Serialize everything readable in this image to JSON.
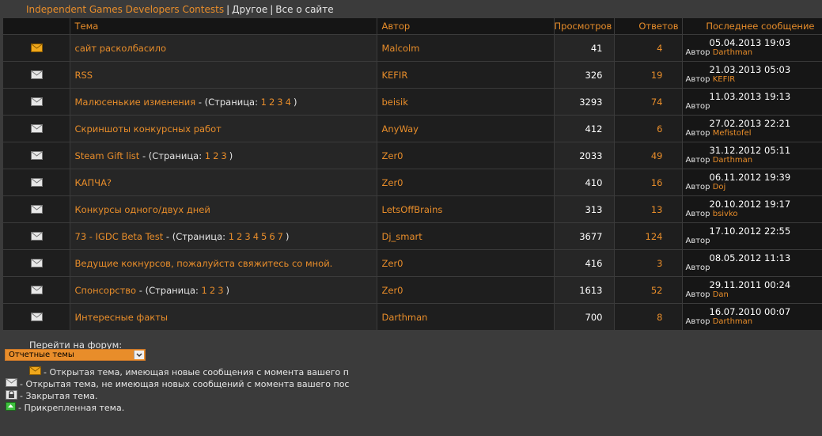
{
  "breadcrumb": {
    "root": "Independent Games Developers Contests",
    "section": "Другое",
    "current": "Все о сайте"
  },
  "table": {
    "headers": {
      "title": "Тема",
      "author": "Автор",
      "views": "Просмотров",
      "replies": "Ответов",
      "last": "Последнее сообщение"
    },
    "page_label": "Страница",
    "by_label": "Автор",
    "rows": [
      {
        "icon": "new",
        "title": "сайт расколбасило",
        "pages": [],
        "author": "Malcolm",
        "views": "41",
        "replies": "4",
        "last_date": "05.04.2013 19:03",
        "last_author": "Darthman"
      },
      {
        "icon": "open",
        "title": "RSS",
        "pages": [],
        "author": "KEFIR",
        "views": "326",
        "replies": "19",
        "last_date": "21.03.2013 05:03",
        "last_author": "KEFIR"
      },
      {
        "icon": "open",
        "title": "Малюсенькие изменения",
        "pages": [
          "1",
          "2",
          "3",
          "4"
        ],
        "author": "beisik",
        "views": "3293",
        "replies": "74",
        "last_date": "11.03.2013 19:13",
        "last_author": ""
      },
      {
        "icon": "open",
        "title": "Скриншоты конкурсных работ",
        "pages": [],
        "author": "AnyWay",
        "views": "412",
        "replies": "6",
        "last_date": "27.02.2013 22:21",
        "last_author": "Mefistofel"
      },
      {
        "icon": "open",
        "title": "Steam Gift list",
        "pages": [
          "1",
          "2",
          "3"
        ],
        "author": "Zer0",
        "views": "2033",
        "replies": "49",
        "last_date": "31.12.2012 05:11",
        "last_author": "Darthman"
      },
      {
        "icon": "open",
        "title": "КАПЧА?",
        "pages": [],
        "author": "Zer0",
        "views": "410",
        "replies": "16",
        "last_date": "06.11.2012 19:39",
        "last_author": "Doj"
      },
      {
        "icon": "open",
        "title": "Конкурсы одного/двух дней",
        "pages": [],
        "author": "LetsOffBrains",
        "views": "313",
        "replies": "13",
        "last_date": "20.10.2012 19:17",
        "last_author": "bsivko"
      },
      {
        "icon": "open",
        "title": "73 - IGDC Beta Test",
        "pages": [
          "1",
          "2",
          "3",
          "4",
          "5",
          "6",
          "7"
        ],
        "author": "Dj_smart",
        "views": "3677",
        "replies": "124",
        "last_date": "17.10.2012 22:55",
        "last_author": ""
      },
      {
        "icon": "open",
        "title": "Ведущие кокнурсов, пожалуйста свяжитесь со мной.",
        "pages": [],
        "author": "Zer0",
        "views": "416",
        "replies": "3",
        "last_date": "08.05.2012 11:13",
        "last_author": ""
      },
      {
        "icon": "open",
        "title": "Спонсорство",
        "pages": [
          "1",
          "2",
          "3"
        ],
        "author": "Zer0",
        "views": "1613",
        "replies": "52",
        "last_date": "29.11.2011 00:24",
        "last_author": "Dan"
      },
      {
        "icon": "open",
        "title": "Интересные факты",
        "pages": [],
        "author": "Darthman",
        "views": "700",
        "replies": "8",
        "last_date": "16.07.2010 00:07",
        "last_author": "Darthman"
      }
    ]
  },
  "jump": {
    "label": "Перейти на форум:",
    "selected": "Отчетные темы"
  },
  "legend": {
    "new": "- Открытая тема, имеющая новые сообщения с момента вашего п",
    "open": "- Открытая тема, не имеющая новых сообщений с момента вашего пос",
    "closed": "- Закрытая тема.",
    "sticky": "- Прикрепленная тема."
  },
  "colors": {
    "accent": "#e88d2a",
    "background": "#3b3b3b",
    "header_bg": "#151515"
  },
  "icons": {
    "new": "envelope-new-icon",
    "open": "envelope-icon",
    "closed": "lock-icon",
    "sticky": "sticky-icon"
  }
}
